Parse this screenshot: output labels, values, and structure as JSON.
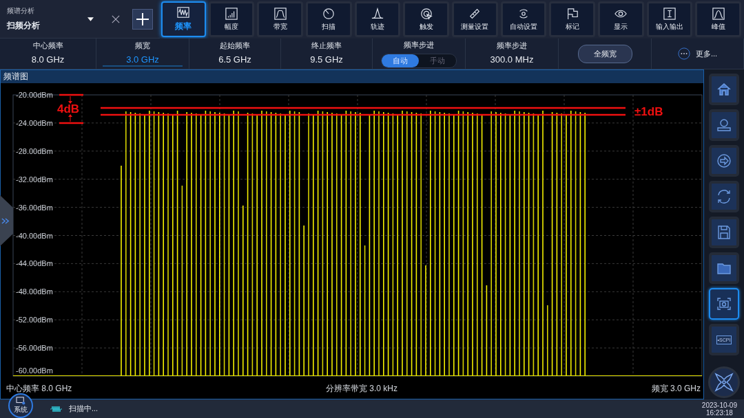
{
  "mode": {
    "caption": "频谱分析",
    "name": "扫频分析"
  },
  "toolbar": [
    {
      "label": "频率",
      "selected": true
    },
    {
      "label": "幅度",
      "selected": false
    },
    {
      "label": "带宽",
      "selected": false
    },
    {
      "label": "扫描",
      "selected": false
    },
    {
      "label": "轨迹",
      "selected": false
    },
    {
      "label": "触发",
      "selected": false
    },
    {
      "label": "测量设置",
      "selected": false
    },
    {
      "label": "自动设置",
      "selected": false
    },
    {
      "label": "标记",
      "selected": false
    },
    {
      "label": "显示",
      "selected": false
    },
    {
      "label": "输入输出",
      "selected": false
    },
    {
      "label": "峰值",
      "selected": false
    }
  ],
  "params": [
    {
      "kind": "value",
      "label": "中心频率",
      "value": "8.0 GHz",
      "selected": false
    },
    {
      "kind": "value",
      "label": "频宽",
      "value": "3.0 GHz",
      "selected": true
    },
    {
      "kind": "value",
      "label": "起始频率",
      "value": "6.5 GHz",
      "selected": false
    },
    {
      "kind": "value",
      "label": "终止频率",
      "value": "9.5 GHz",
      "selected": false
    },
    {
      "kind": "toggle",
      "label": "频率步进",
      "options": [
        {
          "label": "自动",
          "selected": true
        },
        {
          "label": "手动",
          "selected": false
        }
      ]
    },
    {
      "kind": "value",
      "label": "频率步进",
      "value": "300.0 MHz",
      "selected": false
    },
    {
      "kind": "button",
      "label": "全频宽"
    },
    {
      "kind": "more",
      "label": "更多..."
    }
  ],
  "spectrum": {
    "title": "频谱图",
    "y_labels": [
      "-20.00dBm",
      "-24.00dBm",
      "-28.00dBm",
      "-32.00dBm",
      "-36.00dBm",
      "-40.00dBm",
      "-44.00dBm",
      "-48.00dBm",
      "-52.00dBm",
      "-56.00dBm",
      "-60.00dBm"
    ],
    "annotations": {
      "range": "4dB",
      "flatness": "±1dB"
    },
    "footer": {
      "left": "中心频率 8.0 GHz",
      "center": "分辨率带宽 3.0 kHz",
      "right": "频宽 3.0 GHz"
    }
  },
  "side_buttons": [
    {
      "selected": false
    },
    {
      "selected": false
    },
    {
      "selected": false
    },
    {
      "selected": false
    },
    {
      "selected": false
    },
    {
      "selected": false
    },
    {
      "selected": true
    },
    {
      "label": "•SCPI",
      "selected": false
    }
  ],
  "status_bar": {
    "system": "系统",
    "status": "扫描中...",
    "date": "2023-10-09",
    "time": "16:23:18"
  }
}
